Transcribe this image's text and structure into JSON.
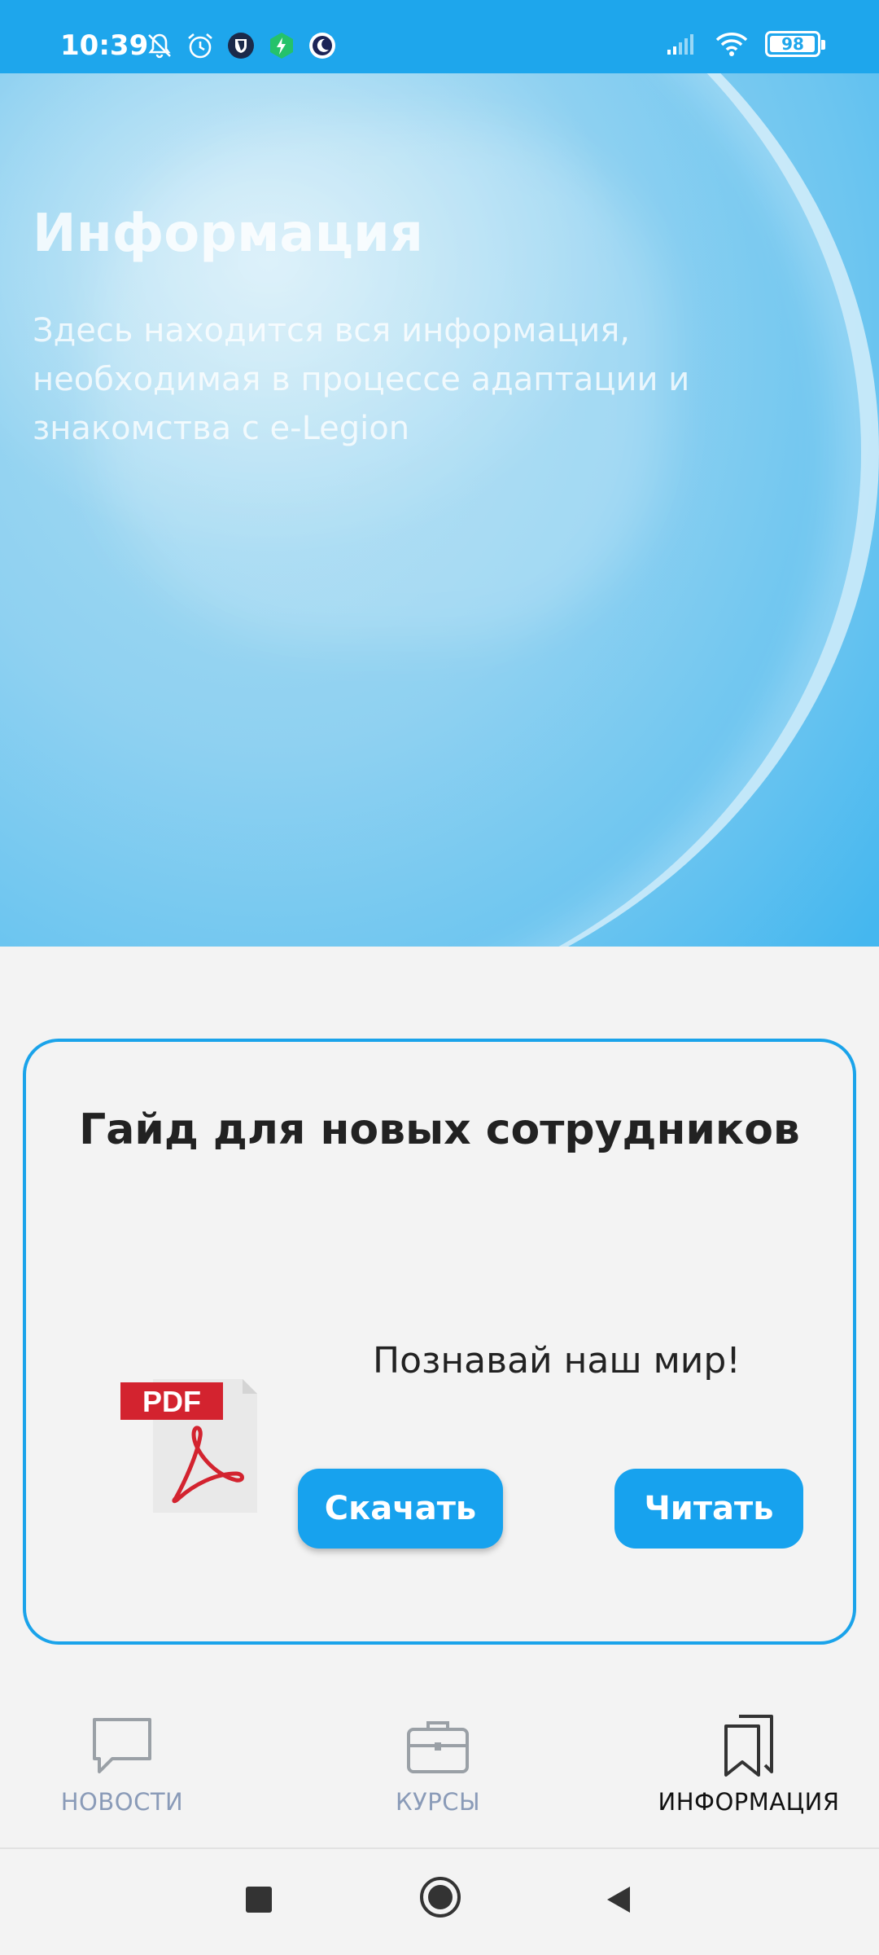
{
  "status_bar": {
    "time": "10:39",
    "icons": [
      "bell-off-icon",
      "alarm-icon",
      "shield-app-icon",
      "bolt-app-icon",
      "moon-app-icon",
      "signal-icon",
      "wifi-icon"
    ],
    "battery": "98",
    "background_color": "#1ea6ec"
  },
  "hero": {
    "title": "Информация",
    "subtitle": "Здесь находится вся информация, необходимая в процессе адаптации и знакомства с e-Legion"
  },
  "guide_card": {
    "title": "Гайд для новых сотрудников",
    "tagline": "Познавай наш мир!",
    "pdf_badge": "PDF",
    "download_label": "Скачать",
    "read_label": "Читать",
    "accent_color": "#1aa3ea"
  },
  "bottom_nav": {
    "items": [
      {
        "label": "НОВОСТИ",
        "icon": "chat-bubble-icon",
        "active": false
      },
      {
        "label": "КУРСЫ",
        "icon": "briefcase-icon",
        "active": false
      },
      {
        "label": "ИНФОРМАЦИЯ",
        "icon": "bookmarks-icon",
        "active": true
      }
    ]
  },
  "system_nav": {
    "icons": [
      "recents-square-icon",
      "home-circle-icon",
      "back-triangle-icon"
    ]
  }
}
